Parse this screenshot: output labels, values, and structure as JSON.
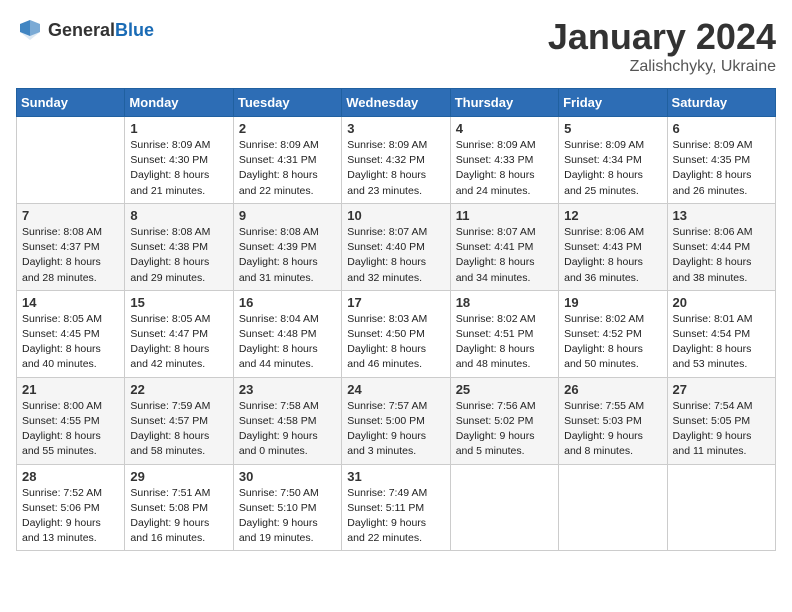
{
  "header": {
    "logo_general": "General",
    "logo_blue": "Blue",
    "month_title": "January 2024",
    "location": "Zalishchyky, Ukraine"
  },
  "weekdays": [
    "Sunday",
    "Monday",
    "Tuesday",
    "Wednesday",
    "Thursday",
    "Friday",
    "Saturday"
  ],
  "weeks": [
    [
      {
        "day": "",
        "sunrise": "",
        "sunset": "",
        "daylight": ""
      },
      {
        "day": "1",
        "sunrise": "Sunrise: 8:09 AM",
        "sunset": "Sunset: 4:30 PM",
        "daylight": "Daylight: 8 hours and 21 minutes."
      },
      {
        "day": "2",
        "sunrise": "Sunrise: 8:09 AM",
        "sunset": "Sunset: 4:31 PM",
        "daylight": "Daylight: 8 hours and 22 minutes."
      },
      {
        "day": "3",
        "sunrise": "Sunrise: 8:09 AM",
        "sunset": "Sunset: 4:32 PM",
        "daylight": "Daylight: 8 hours and 23 minutes."
      },
      {
        "day": "4",
        "sunrise": "Sunrise: 8:09 AM",
        "sunset": "Sunset: 4:33 PM",
        "daylight": "Daylight: 8 hours and 24 minutes."
      },
      {
        "day": "5",
        "sunrise": "Sunrise: 8:09 AM",
        "sunset": "Sunset: 4:34 PM",
        "daylight": "Daylight: 8 hours and 25 minutes."
      },
      {
        "day": "6",
        "sunrise": "Sunrise: 8:09 AM",
        "sunset": "Sunset: 4:35 PM",
        "daylight": "Daylight: 8 hours and 26 minutes."
      }
    ],
    [
      {
        "day": "7",
        "sunrise": "Sunrise: 8:08 AM",
        "sunset": "Sunset: 4:37 PM",
        "daylight": "Daylight: 8 hours and 28 minutes."
      },
      {
        "day": "8",
        "sunrise": "Sunrise: 8:08 AM",
        "sunset": "Sunset: 4:38 PM",
        "daylight": "Daylight: 8 hours and 29 minutes."
      },
      {
        "day": "9",
        "sunrise": "Sunrise: 8:08 AM",
        "sunset": "Sunset: 4:39 PM",
        "daylight": "Daylight: 8 hours and 31 minutes."
      },
      {
        "day": "10",
        "sunrise": "Sunrise: 8:07 AM",
        "sunset": "Sunset: 4:40 PM",
        "daylight": "Daylight: 8 hours and 32 minutes."
      },
      {
        "day": "11",
        "sunrise": "Sunrise: 8:07 AM",
        "sunset": "Sunset: 4:41 PM",
        "daylight": "Daylight: 8 hours and 34 minutes."
      },
      {
        "day": "12",
        "sunrise": "Sunrise: 8:06 AM",
        "sunset": "Sunset: 4:43 PM",
        "daylight": "Daylight: 8 hours and 36 minutes."
      },
      {
        "day": "13",
        "sunrise": "Sunrise: 8:06 AM",
        "sunset": "Sunset: 4:44 PM",
        "daylight": "Daylight: 8 hours and 38 minutes."
      }
    ],
    [
      {
        "day": "14",
        "sunrise": "Sunrise: 8:05 AM",
        "sunset": "Sunset: 4:45 PM",
        "daylight": "Daylight: 8 hours and 40 minutes."
      },
      {
        "day": "15",
        "sunrise": "Sunrise: 8:05 AM",
        "sunset": "Sunset: 4:47 PM",
        "daylight": "Daylight: 8 hours and 42 minutes."
      },
      {
        "day": "16",
        "sunrise": "Sunrise: 8:04 AM",
        "sunset": "Sunset: 4:48 PM",
        "daylight": "Daylight: 8 hours and 44 minutes."
      },
      {
        "day": "17",
        "sunrise": "Sunrise: 8:03 AM",
        "sunset": "Sunset: 4:50 PM",
        "daylight": "Daylight: 8 hours and 46 minutes."
      },
      {
        "day": "18",
        "sunrise": "Sunrise: 8:02 AM",
        "sunset": "Sunset: 4:51 PM",
        "daylight": "Daylight: 8 hours and 48 minutes."
      },
      {
        "day": "19",
        "sunrise": "Sunrise: 8:02 AM",
        "sunset": "Sunset: 4:52 PM",
        "daylight": "Daylight: 8 hours and 50 minutes."
      },
      {
        "day": "20",
        "sunrise": "Sunrise: 8:01 AM",
        "sunset": "Sunset: 4:54 PM",
        "daylight": "Daylight: 8 hours and 53 minutes."
      }
    ],
    [
      {
        "day": "21",
        "sunrise": "Sunrise: 8:00 AM",
        "sunset": "Sunset: 4:55 PM",
        "daylight": "Daylight: 8 hours and 55 minutes."
      },
      {
        "day": "22",
        "sunrise": "Sunrise: 7:59 AM",
        "sunset": "Sunset: 4:57 PM",
        "daylight": "Daylight: 8 hours and 58 minutes."
      },
      {
        "day": "23",
        "sunrise": "Sunrise: 7:58 AM",
        "sunset": "Sunset: 4:58 PM",
        "daylight": "Daylight: 9 hours and 0 minutes."
      },
      {
        "day": "24",
        "sunrise": "Sunrise: 7:57 AM",
        "sunset": "Sunset: 5:00 PM",
        "daylight": "Daylight: 9 hours and 3 minutes."
      },
      {
        "day": "25",
        "sunrise": "Sunrise: 7:56 AM",
        "sunset": "Sunset: 5:02 PM",
        "daylight": "Daylight: 9 hours and 5 minutes."
      },
      {
        "day": "26",
        "sunrise": "Sunrise: 7:55 AM",
        "sunset": "Sunset: 5:03 PM",
        "daylight": "Daylight: 9 hours and 8 minutes."
      },
      {
        "day": "27",
        "sunrise": "Sunrise: 7:54 AM",
        "sunset": "Sunset: 5:05 PM",
        "daylight": "Daylight: 9 hours and 11 minutes."
      }
    ],
    [
      {
        "day": "28",
        "sunrise": "Sunrise: 7:52 AM",
        "sunset": "Sunset: 5:06 PM",
        "daylight": "Daylight: 9 hours and 13 minutes."
      },
      {
        "day": "29",
        "sunrise": "Sunrise: 7:51 AM",
        "sunset": "Sunset: 5:08 PM",
        "daylight": "Daylight: 9 hours and 16 minutes."
      },
      {
        "day": "30",
        "sunrise": "Sunrise: 7:50 AM",
        "sunset": "Sunset: 5:10 PM",
        "daylight": "Daylight: 9 hours and 19 minutes."
      },
      {
        "day": "31",
        "sunrise": "Sunrise: 7:49 AM",
        "sunset": "Sunset: 5:11 PM",
        "daylight": "Daylight: 9 hours and 22 minutes."
      },
      {
        "day": "",
        "sunrise": "",
        "sunset": "",
        "daylight": ""
      },
      {
        "day": "",
        "sunrise": "",
        "sunset": "",
        "daylight": ""
      },
      {
        "day": "",
        "sunrise": "",
        "sunset": "",
        "daylight": ""
      }
    ]
  ]
}
